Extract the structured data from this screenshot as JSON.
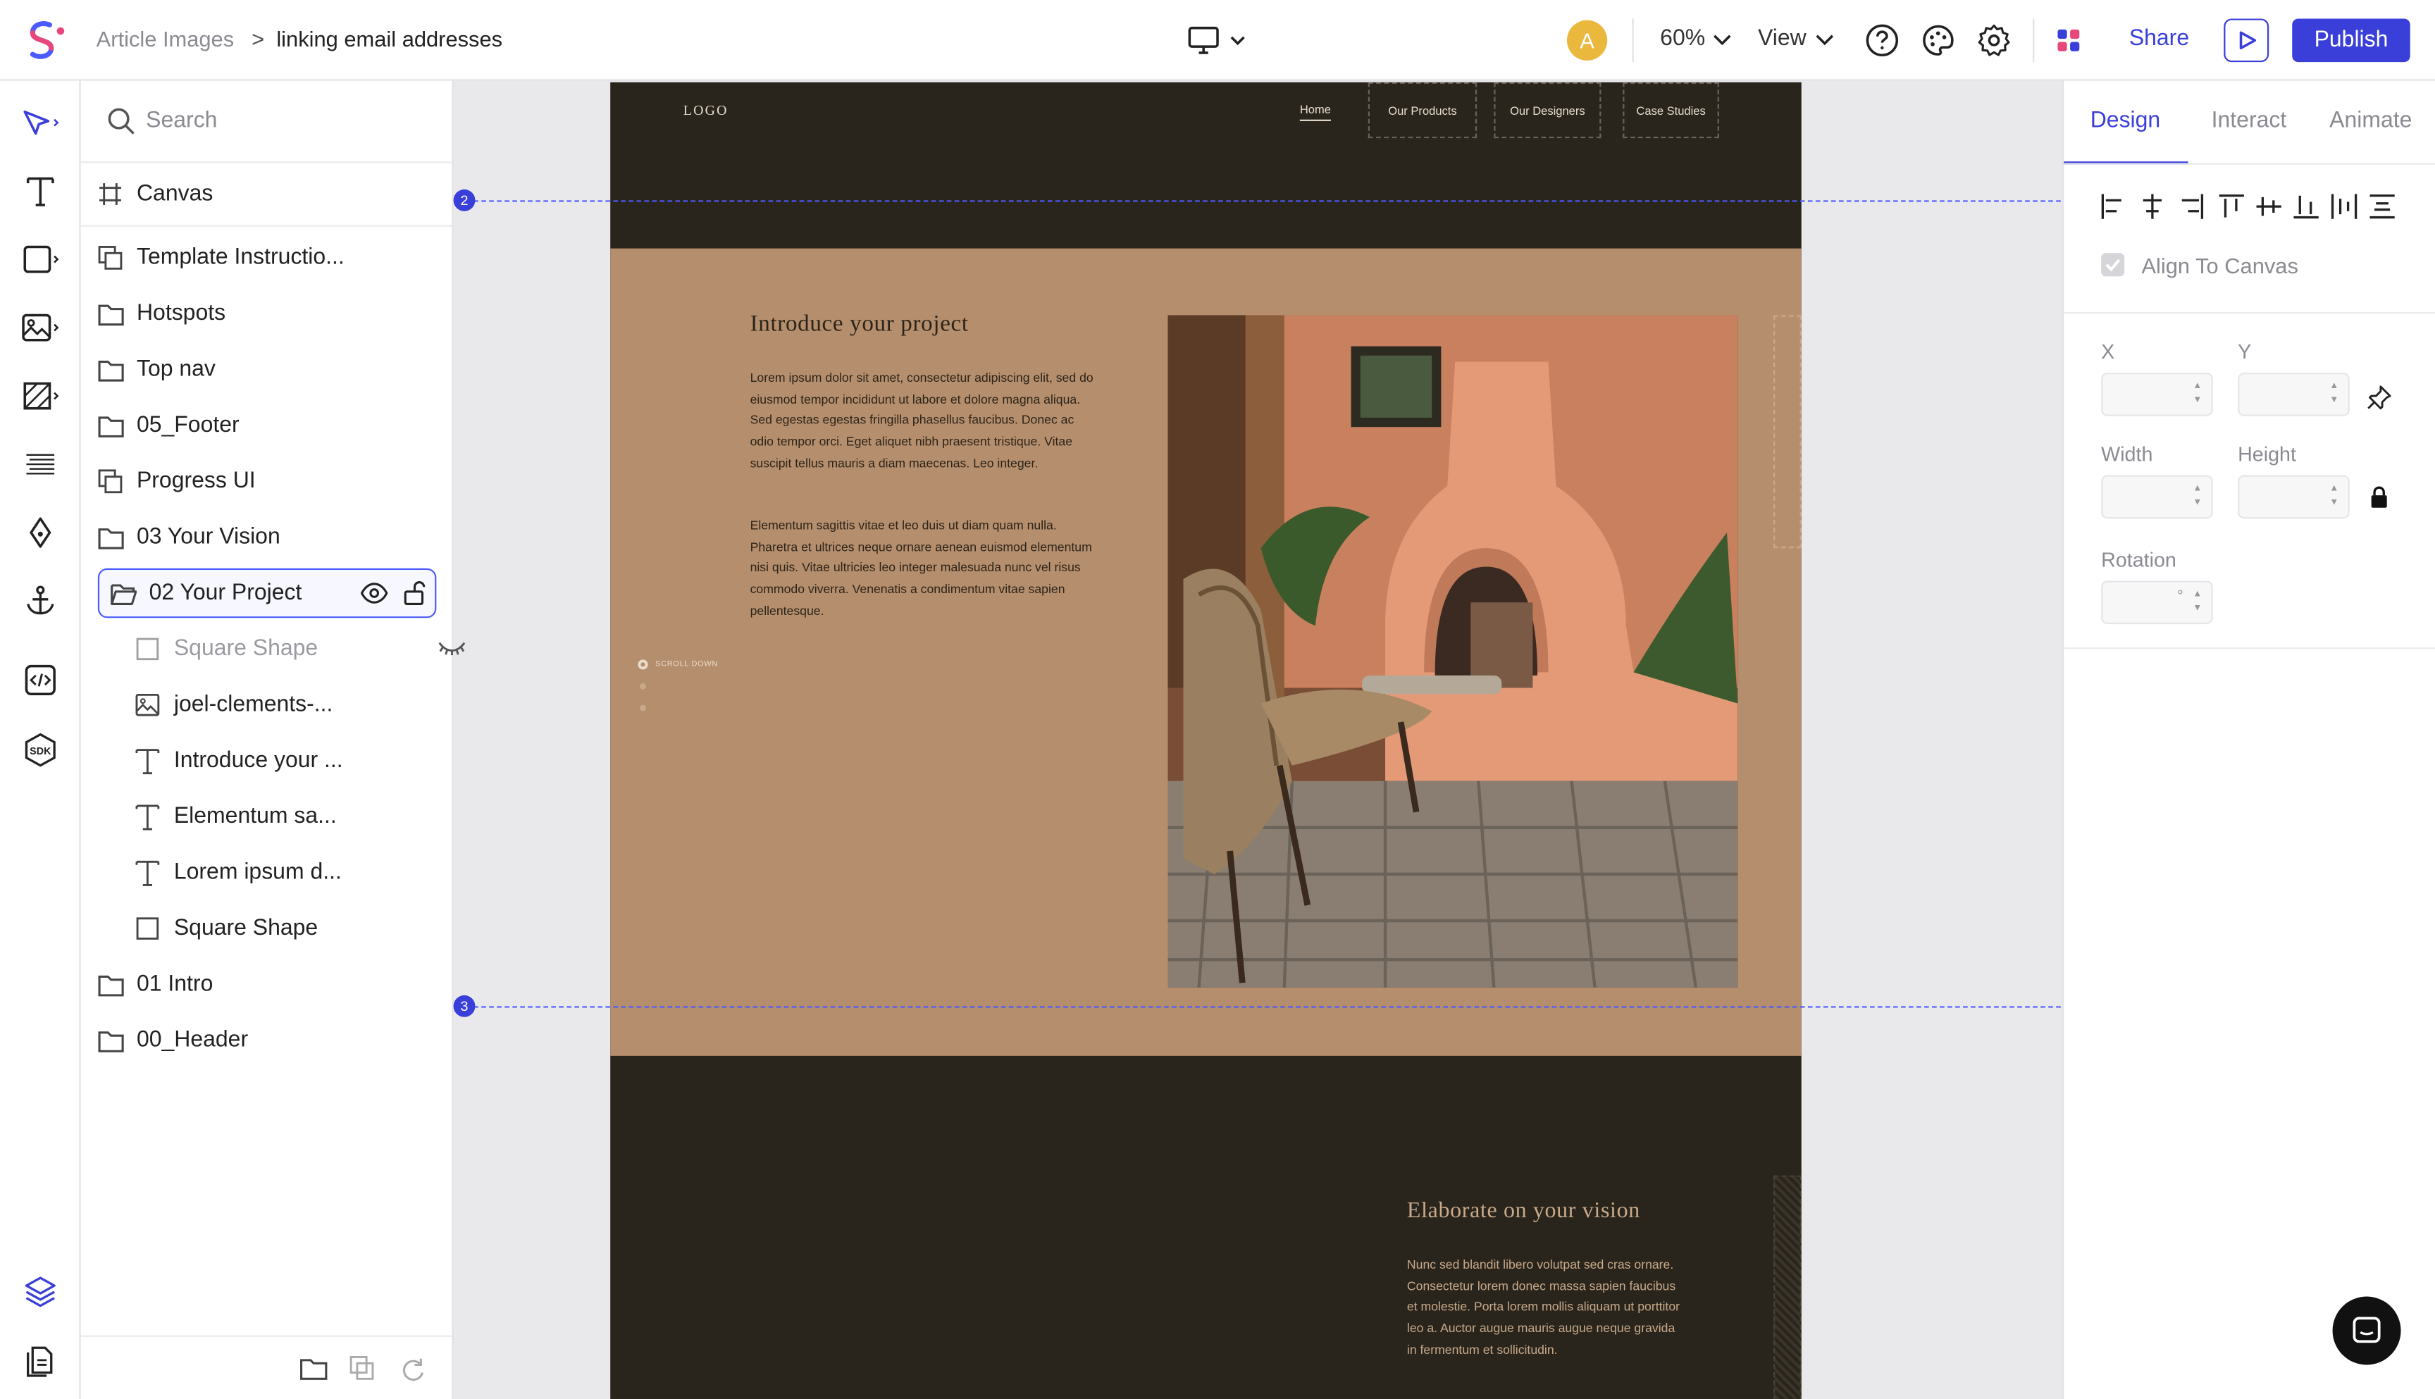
{
  "breadcrumb": {
    "parent": "Article Images",
    "separator": ">",
    "current": "linking email addresses"
  },
  "topbar": {
    "avatar_initial": "A",
    "zoom": "60%",
    "view_label": "View",
    "share_label": "Share",
    "publish_label": "Publish",
    "brand_color": "#3a3fd9"
  },
  "layers": {
    "search_placeholder": "Search",
    "canvas_label": "Canvas",
    "items": [
      {
        "label": "Template Instructio...",
        "icon": "component-icon"
      },
      {
        "label": "Hotspots",
        "icon": "folder-icon"
      },
      {
        "label": "Top nav",
        "icon": "folder-icon"
      },
      {
        "label": "05_Footer",
        "icon": "folder-icon"
      },
      {
        "label": "Progress UI",
        "icon": "component-icon"
      },
      {
        "label": "03 Your Vision",
        "icon": "folder-icon"
      },
      {
        "label": "02 Your Project",
        "icon": "folder-open-icon",
        "selected": true
      },
      {
        "label": "Square Shape",
        "icon": "square-icon",
        "hidden": true
      },
      {
        "label": "joel-clements-...",
        "icon": "image-icon"
      },
      {
        "label": "Introduce your ...",
        "icon": "text-icon"
      },
      {
        "label": "Elementum sa...",
        "icon": "text-icon"
      },
      {
        "label": "Lorem ipsum d...",
        "icon": "text-icon"
      },
      {
        "label": "Square Shape",
        "icon": "square-icon"
      },
      {
        "label": "01 Intro",
        "icon": "folder-icon"
      },
      {
        "label": "00_Header",
        "icon": "folder-icon"
      }
    ]
  },
  "artboard": {
    "logo": "LOGO",
    "nav": [
      "Home",
      "Our Products",
      "Our Designers",
      "Case Studies"
    ],
    "guide_badges": [
      "2",
      "3"
    ],
    "section_title": "Introduce your project",
    "para1": "Lorem ipsum dolor sit amet, consectetur adipiscing elit, sed do eiusmod tempor incididunt ut labore et dolore magna aliqua. Sed egestas egestas fringilla phasellus faucibus. Donec ac odio tempor orci. Eget aliquet nibh praesent tristique. Vitae suscipit tellus mauris a diam maecenas. Leo integer.",
    "para2": "Elementum sagittis vitae et leo duis ut diam quam nulla. Pharetra et ultrices neque ornare aenean euismod elementum nisi quis. Vitae ultricies leo integer malesuada nunc vel risus commodo viverra. Venenatis a condimentum vitae sapien pellentesque.",
    "scroll_label": "SCROLL DOWN",
    "vision_title": "Elaborate on your vision",
    "vision_text": "Nunc sed blandit libero volutpat sed cras ornare. Consectetur lorem donec massa sapien faucibus et molestie. Porta lorem mollis aliquam ut porttitor leo a. Auctor augue mauris augue neque gravida in fermentum et sollicitudin."
  },
  "rpanel": {
    "tabs": [
      "Design",
      "Interact",
      "Animate"
    ],
    "align_to_canvas": "Align To Canvas",
    "x_label": "X",
    "y_label": "Y",
    "width_label": "Width",
    "height_label": "Height",
    "rotation_label": "Rotation",
    "rotation_unit": "°"
  }
}
